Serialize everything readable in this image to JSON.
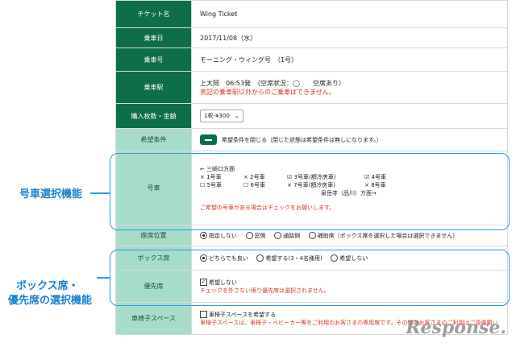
{
  "rows": {
    "ticket": {
      "label": "チケット名",
      "value": "Wing Ticket"
    },
    "date": {
      "label": "乗車日",
      "value": "2017/11/08（水）"
    },
    "train": {
      "label": "乗車号",
      "value": "モーニング・ウィング号　（1号）"
    },
    "station": {
      "label": "乗車駅",
      "value": "上大岡　06:53発　（空席状況：◯　　空席あり）",
      "note": "表記の乗車駅以外からのご乗車はできません。"
    },
    "quantity": {
      "label": "購入枚数・金額",
      "selected": "1枚-¥300"
    },
    "conditions": {
      "label": "希望条件",
      "text": "希望条件を閉じる（閉じた状態は希望条件は無しになります。）"
    },
    "car": {
      "label": "号車",
      "direction_top": "← 三崎口方面",
      "direction_bottom": "泉岳寺（品川）方面→",
      "cars": [
        {
          "label": "1号車",
          "mark": "×"
        },
        {
          "label": "2号車",
          "mark": "×"
        },
        {
          "label": "3号車(額冷房車)",
          "mark": "☑"
        },
        {
          "label": "4号車",
          "mark": "☑"
        },
        {
          "label": "5号車",
          "mark": "☐"
        },
        {
          "label": "6号車",
          "mark": "☐"
        },
        {
          "label": "7号車(額冷房車)",
          "mark": "×"
        },
        {
          "label": "8号車",
          "mark": "×"
        }
      ],
      "note": "ご希望の号車がある場合はチェックをお願いします。"
    },
    "seat_position": {
      "label": "座席位置",
      "options": [
        "指定しない",
        "窓側",
        "通路側",
        "補助席（ボックス席を選択した場合は選択できません）"
      ],
      "selected_index": 0
    },
    "box_seat": {
      "label": "ボックス席",
      "options": [
        "どちらでも良い",
        "希望する(3・4名様用)",
        "希望しない"
      ],
      "selected_index": 0
    },
    "priority": {
      "label": "優先席",
      "checkbox_label": "希望しない",
      "note": "チェックを外さない限り優先席は選択されません。"
    },
    "wheelchair": {
      "label": "車椅子スペース",
      "checkbox_label": "車椅子スペースを希望する",
      "note": "車椅子スペースは、車椅子・ベビーカー等をご利用のお客さまの専用席です。その他のお客さまのご利用はご遠慮願います。"
    }
  },
  "annotations": {
    "car_select": "号車選択機能",
    "box_priority_line1": "ボックス席・",
    "box_priority_line2": "優先席の選択機能"
  },
  "watermark": "Response.",
  "colors": {
    "label_dark": "#0e6e47",
    "label_light": "#a7dcc9",
    "note_red": "#e0322a",
    "callout_blue": "#1a7fcf"
  }
}
